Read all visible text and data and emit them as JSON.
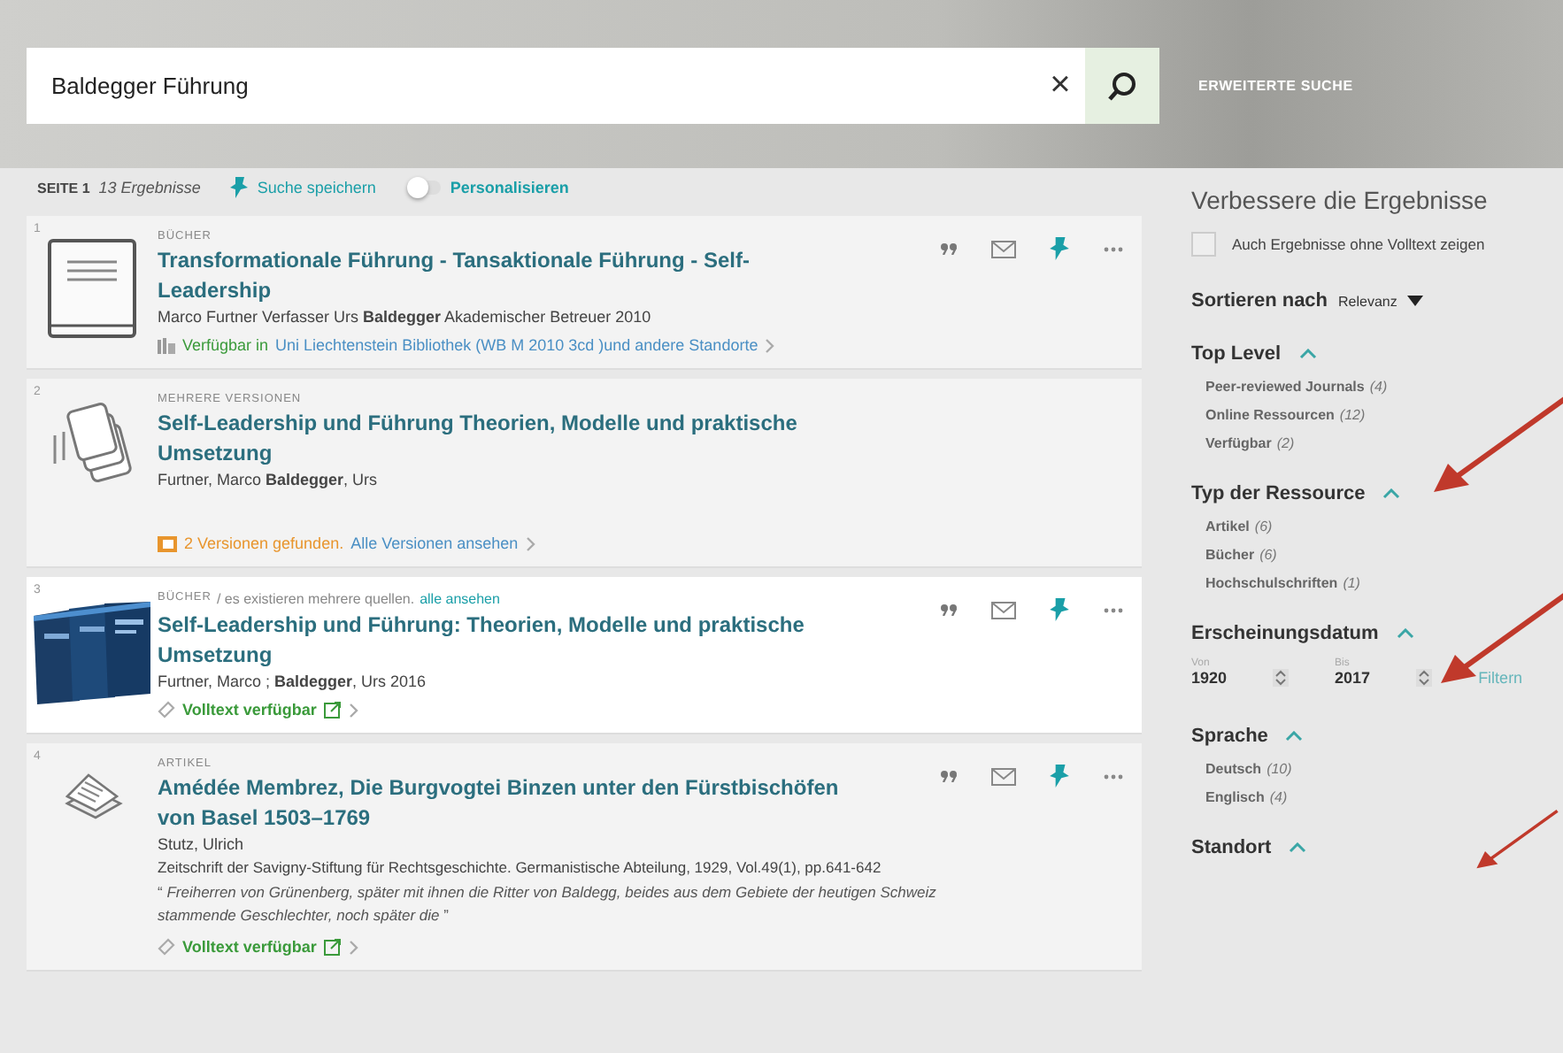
{
  "search": {
    "value": "Baldegger Führung",
    "clear": "×",
    "advanced": "ERWEITERTE SUCHE"
  },
  "toolbar": {
    "page": "SEITE 1",
    "count": "13 Ergebnisse",
    "save": "Suche speichern",
    "personalize": "Personalisieren",
    "personalize_on": false
  },
  "results": [
    {
      "number": "1",
      "selected": false,
      "kind": "book",
      "type": "BÜCHER",
      "title": "Transformationale **Führung** - Tansaktionale **Führung** - Self-Leadership",
      "authors": "Marco Furtner Verfasser Urs **Baldegger** Akademischer Betreuer 2010",
      "actions": true,
      "availability": {
        "kind": "location",
        "status": "Verfügbar in",
        "link": "Uni Liechtenstein  Bibliothek (WB M 2010 3cd )und andere Standorte"
      }
    },
    {
      "number": "2",
      "selected": false,
      "kind": "versions",
      "type": "MEHRERE VERSIONEN",
      "title": "Self-Leadership und **Führung** Theorien, Modelle und praktische Umsetzung",
      "authors": "Furtner, Marco **Baldegger**, Urs",
      "actions": false,
      "availability": {
        "kind": "versions",
        "status": "2 Versionen gefunden.",
        "link": "Alle Versionen ansehen"
      }
    },
    {
      "number": "3",
      "selected": true,
      "kind": "picture",
      "type": "BÜCHER",
      "type_note": "/ es existieren mehrere quellen.",
      "type_link": "alle ansehen",
      "title": "Self-Leadership und **Führung**: Theorien, Modelle und praktische Umsetzung",
      "authors": "Furtner, Marco ; **Baldegger**, Urs 2016",
      "actions": true,
      "availability": {
        "kind": "fulltext",
        "status": "Volltext verfügbar"
      }
    },
    {
      "number": "4",
      "selected": false,
      "kind": "article",
      "type": "ARTIKEL",
      "title": "Amédée Membrez, Die Burgvogtei Binzen unter den Fürstbischöfen von Basel 1503–1769",
      "authors": "Stutz, Ulrich",
      "extra": [
        {
          "kind": "source",
          "text": "Zeitschrift der Savigny-Stiftung für Rechtsgeschichte. Germanistische Abteilung, 1929, Vol.49(1), pp.641-642"
        },
        {
          "kind": "snippet",
          "text": "“ *Freiherren von Grünenberg, später mit ihnen die Ritter von Baldegg, beides aus dem Gebiete der heutigen Schweiz stammende Geschlechter, noch später die* ”"
        }
      ],
      "actions": true,
      "availability": {
        "kind": "fulltext",
        "status": "Volltext verfügbar"
      }
    }
  ],
  "sidebar": {
    "title": "Verbessere die Ergebnisse",
    "checkbox": {
      "label": "Auch Ergebnisse ohne Volltext zeigen",
      "checked": false
    },
    "sort_label": "Sortieren nach",
    "sort_value": "Relevanz",
    "facets": [
      {
        "kind": "list",
        "title": "Top Level",
        "expanded": true,
        "items": [
          {
            "label": "Peer-reviewed Journals",
            "count": "(4)"
          },
          {
            "label": "Online Ressourcen",
            "count": "(12)"
          },
          {
            "label": "Verfügbar",
            "count": "(2)"
          }
        ]
      },
      {
        "kind": "list",
        "title": "Typ der Ressource",
        "expanded": true,
        "items": [
          {
            "label": "Artikel",
            "count": "(6)"
          },
          {
            "label": "Bücher",
            "count": "(6)"
          },
          {
            "label": "Hochschulschriften",
            "count": "(1)"
          }
        ]
      },
      {
        "kind": "range",
        "title": "Erscheinungsdatum",
        "expanded": true,
        "from_label": "Von",
        "from": "1920",
        "to_label": "Bis",
        "to": "2017",
        "button": "Filtern"
      },
      {
        "kind": "list",
        "title": "Sprache",
        "expanded": true,
        "items": [
          {
            "label": "Deutsch",
            "count": "(10)"
          },
          {
            "label": "Englisch",
            "count": "(4)"
          }
        ]
      },
      {
        "kind": "list",
        "title": "Standort",
        "expanded": true
      }
    ]
  }
}
